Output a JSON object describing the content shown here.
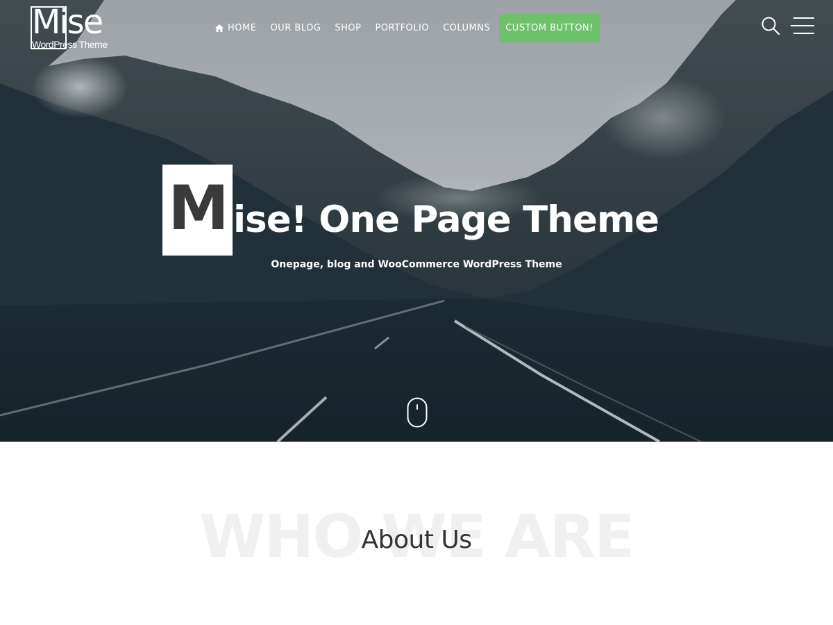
{
  "header": {
    "logo": {
      "word": "Mise",
      "tagline": "WordPress Theme"
    },
    "nav": [
      {
        "label": "HOME",
        "icon": "home-icon"
      },
      {
        "label": "OUR BLOG"
      },
      {
        "label": "SHOP"
      },
      {
        "label": "PORTFOLIO"
      },
      {
        "label": "COLUMNS"
      }
    ],
    "cta_button": "CUSTOM BUTTON!",
    "icons": {
      "search": "search-icon",
      "menu": "hamburger-menu-icon"
    }
  },
  "hero": {
    "title_initial": "M",
    "title_rest": "ise! One Page Theme",
    "subtitle": "Onepage, blog and WooCommerce WordPress Theme",
    "scroll_icon": "mouse-scroll-icon"
  },
  "about": {
    "background_text": "WHO WE ARE",
    "title": "About Us"
  },
  "colors": {
    "accent": "#6cc16a",
    "hero_overlay": "#1b2a33",
    "text_dark": "#333333",
    "watermark": "#f0f0f0"
  }
}
